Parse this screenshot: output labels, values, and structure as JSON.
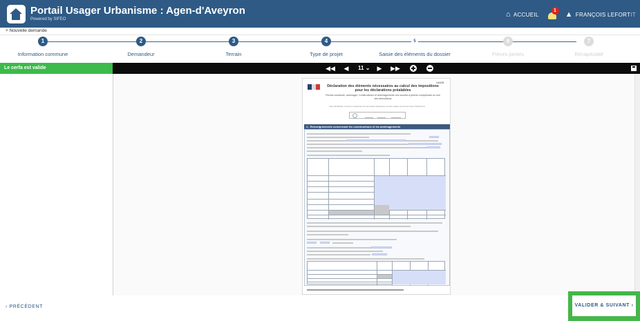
{
  "header": {
    "title": "Portail Usager Urbanisme : Agen-d'Aveyron",
    "powered_by": "Powered by SIFEO",
    "home_label": "ACCUEIL",
    "notification_count": "1",
    "user_label": "FRANÇOIS LEFORT",
    "user_suffix": "IT"
  },
  "breadcrumb": {
    "label": "Nouvelle demande"
  },
  "steps": [
    {
      "number": "1",
      "label": "Information commune",
      "state": "done"
    },
    {
      "number": "2",
      "label": "Demandeur",
      "state": "done"
    },
    {
      "number": "3",
      "label": "Terrain",
      "state": "done"
    },
    {
      "number": "4",
      "label": "Type de projet",
      "state": "done"
    },
    {
      "number": "5",
      "label": "Saisie des éléments du dossier",
      "state": "current"
    },
    {
      "number": "6",
      "label": "Pièces jointes",
      "state": "future"
    },
    {
      "number": "7",
      "label": "Récapitulatif",
      "state": "future"
    }
  ],
  "toolbar": {
    "status": "Le cerfa est valide",
    "page": "11",
    "page_caret": "⌄"
  },
  "document": {
    "cerfa_tag": "14428",
    "title": "Déclaration des éléments nécessaires au calcul des impositions pour les déclarations préalables",
    "subtitle": "Permis construire, aménager, Constructions et aménagements non soumis à permis comprenant ou non des démolitions",
    "note": "Cette déclaration concerne uniquement les demandes déposées pour des projets soumis aux taxes d'urbanisme",
    "section_title": "1 - Renseignements concernant les constructions et les aménagements"
  },
  "footer": {
    "prev_label": "‹ PRÉCÉDENT",
    "next_label": "VALIDER & SUIVANT ›"
  },
  "colors": {
    "brand": "#2e5a85",
    "valid": "#3cba4a",
    "toolbar": "#0c0c0c"
  }
}
